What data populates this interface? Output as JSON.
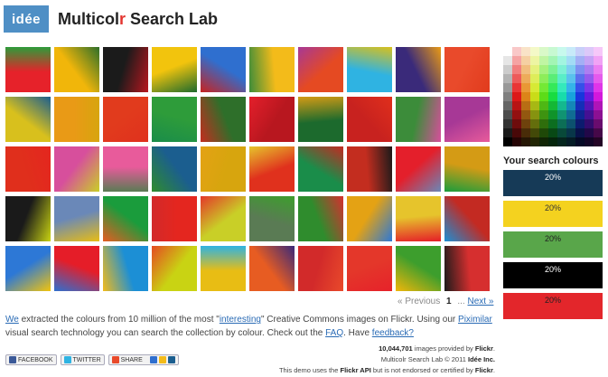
{
  "header": {
    "logo_text": "idée",
    "title_prefix": "Multicol",
    "title_accent": "r",
    "title_suffix": " Search Lab"
  },
  "thumbnails": [
    [
      "#e6222a",
      "#f1b60a",
      "#1b1b1b",
      "#f2c40d",
      "#2f6fcf",
      "#f3bb1a",
      "#e54a22",
      "#2fb3e2",
      "#3a2a7a",
      "#e94a2b"
    ],
    [
      "#d8c01d",
      "#e99a16",
      "#e13b1d",
      "#2e9c3a",
      "#2e6f2a",
      "#b8171f",
      "#1c6a2d",
      "#c8221f",
      "#3c8c3a",
      "#a73896"
    ],
    [
      "#e02f1c",
      "#d74f9c",
      "#e85b9b",
      "#1b5e8f",
      "#d7a50e",
      "#e0311d",
      "#1a8d4a",
      "#c32d1f",
      "#e41f2b",
      "#d49b15"
    ],
    [
      "#1a1a1a",
      "#6a88b8",
      "#1a9c3c",
      "#e4261f",
      "#c9cf27",
      "#5a7b54",
      "#2f8c2d",
      "#e4a214",
      "#e6c42c",
      "#c32a22"
    ],
    [
      "#2d78d6",
      "#e51d28",
      "#1c8fd5",
      "#c9d313",
      "#e8bd14",
      "#e75c22",
      "#d22a2a",
      "#e4372a",
      "#3d9e2d",
      "#d62f2f"
    ]
  ],
  "pagination": {
    "previous_label": "« Previous",
    "current_page": "1",
    "ellipsis": "...",
    "next_label": "Next »"
  },
  "your_colours": {
    "title": "Your search colours",
    "swatches": [
      {
        "pct": "20%",
        "bg": "#163a57",
        "fg": "#ffffff"
      },
      {
        "pct": "20%",
        "bg": "#f4d21f",
        "fg": "#333333"
      },
      {
        "pct": "20%",
        "bg": "#59a64a",
        "fg": "#222222"
      },
      {
        "pct": "20%",
        "bg": "#000000",
        "fg": "#ffffff"
      },
      {
        "pct": "20%",
        "bg": "#e3262b",
        "fg": "#222222"
      }
    ]
  },
  "description": {
    "we": "We",
    "t1": " extracted the colours from 10 million of the most \"",
    "interesting": "interesting",
    "t2": "\" Creative Commons images on Flickr. Using our ",
    "piximilar": "Piximilar",
    "t3": " visual search technology you can search the collection by colour. Check out the ",
    "faq": "FAQ",
    "t4": ". Have ",
    "feedback": "feedback?",
    "t5": ""
  },
  "share": {
    "facebook": "FACEBOOK",
    "twitter": "TWITTER",
    "share": "SHARE"
  },
  "footer": {
    "count": "10,044,701",
    "count_text": " images provided by ",
    "flickr": "Flickr",
    "line2": "Multicolr Search Lab © 2011 ",
    "idee": "Idée Inc.",
    "line3a": "This demo uses the ",
    "flickr_api": "Flickr API",
    "line3b": " but is not endorsed or certified by ",
    "flickr2": "Flickr"
  },
  "colors": {
    "link": "#2a6bb5",
    "brand": "#4f8fc5",
    "accent": "#e3342f"
  }
}
